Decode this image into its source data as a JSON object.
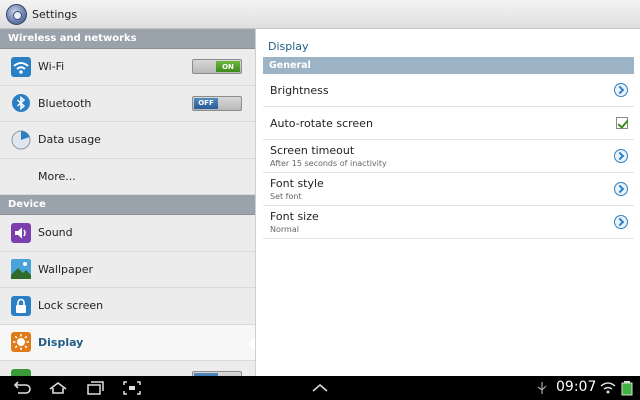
{
  "app": {
    "title": "Settings"
  },
  "left_panel": {
    "sections": [
      {
        "header": "Wireless and networks",
        "items": [
          {
            "label": "Wi-Fi",
            "icon": "wifi-icon",
            "toggle": "ON"
          },
          {
            "label": "Bluetooth",
            "icon": "bluetooth-icon",
            "toggle": "OFF"
          },
          {
            "label": "Data usage",
            "icon": "data-usage-icon"
          },
          {
            "label": "More..."
          }
        ]
      },
      {
        "header": "Device",
        "items": [
          {
            "label": "Sound",
            "icon": "sound-icon"
          },
          {
            "label": "Wallpaper",
            "icon": "wallpaper-icon"
          },
          {
            "label": "Lock screen",
            "icon": "lock-screen-icon"
          },
          {
            "label": "Display",
            "icon": "display-icon",
            "selected": true
          }
        ]
      }
    ]
  },
  "right_panel": {
    "title": "Display",
    "section_header": "General",
    "items": [
      {
        "label": "Brightness",
        "control": "chevron"
      },
      {
        "label": "Auto-rotate screen",
        "control": "checkbox",
        "checked": true
      },
      {
        "label": "Screen timeout",
        "sub": "After 15 seconds of inactivity",
        "control": "chevron"
      },
      {
        "label": "Font style",
        "sub": "Set font",
        "control": "chevron"
      },
      {
        "label": "Font size",
        "sub": "Normal",
        "control": "chevron"
      }
    ]
  },
  "status_bar": {
    "time": "09:07"
  },
  "colors": {
    "accent": "#1f5f86",
    "section_header": "#9aa2ab",
    "toggle_on": "#4a9a25",
    "toggle_off": "#2a5d94"
  }
}
